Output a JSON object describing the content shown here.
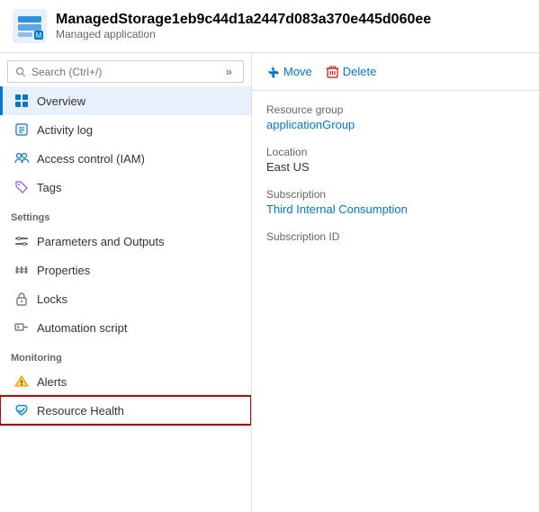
{
  "header": {
    "title": "ManagedStorage1eb9c44d1a2447d083a370e445d060ee",
    "subtitle": "Managed application"
  },
  "search": {
    "placeholder": "Search (Ctrl+/)"
  },
  "nav": {
    "main_items": [
      {
        "id": "overview",
        "label": "Overview",
        "active": true,
        "icon": "overview"
      },
      {
        "id": "activity-log",
        "label": "Activity log",
        "active": false,
        "icon": "activity"
      },
      {
        "id": "access-control",
        "label": "Access control (IAM)",
        "active": false,
        "icon": "access"
      },
      {
        "id": "tags",
        "label": "Tags",
        "active": false,
        "icon": "tags"
      }
    ],
    "settings_label": "Settings",
    "settings_items": [
      {
        "id": "parameters",
        "label": "Parameters and Outputs",
        "active": false,
        "icon": "parameters"
      },
      {
        "id": "properties",
        "label": "Properties",
        "active": false,
        "icon": "properties"
      },
      {
        "id": "locks",
        "label": "Locks",
        "active": false,
        "icon": "locks"
      },
      {
        "id": "automation",
        "label": "Automation script",
        "active": false,
        "icon": "automation"
      }
    ],
    "monitoring_label": "Monitoring",
    "monitoring_items": [
      {
        "id": "alerts",
        "label": "Alerts",
        "active": false,
        "icon": "alerts"
      },
      {
        "id": "resource-health",
        "label": "Resource Health",
        "active": false,
        "icon": "resource-health",
        "highlighted": true
      }
    ]
  },
  "toolbar": {
    "move_label": "Move",
    "delete_label": "Delete"
  },
  "properties": {
    "resource_group_label": "Resource group",
    "resource_group_value": "applicationGroup",
    "location_label": "Location",
    "location_value": "East US",
    "subscription_label": "Subscription",
    "subscription_value": "Third Internal Consumption",
    "subscription_id_label": "Subscription ID",
    "subscription_id_value": ""
  }
}
